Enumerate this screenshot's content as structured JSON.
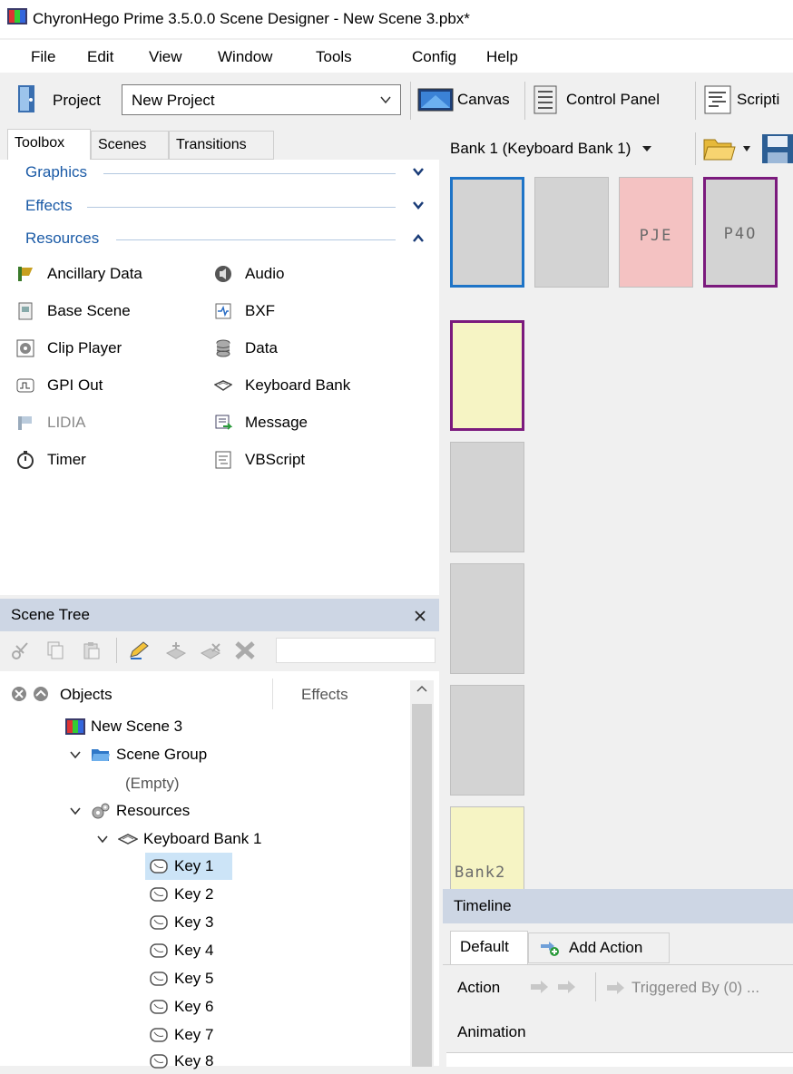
{
  "window": {
    "title": "ChyronHego Prime 3.5.0.0 Scene Designer - New Scene 3.pbx*"
  },
  "menu": [
    "File",
    "Edit",
    "View",
    "Window",
    "Tools",
    "Config",
    "Help"
  ],
  "project": {
    "label": "Project",
    "value": "New Project"
  },
  "view_buttons": {
    "canvas": "Canvas",
    "control_panel": "Control Panel",
    "scripting": "Scripti"
  },
  "left_tabs": [
    "Toolbox",
    "Scenes",
    "Transitions"
  ],
  "toolbox": {
    "sections": [
      "Graphics",
      "Effects",
      "Resources"
    ],
    "items_left": [
      "Ancillary Data",
      "Base Scene",
      "Clip Player",
      "GPI Out",
      "LIDIA",
      "Timer"
    ],
    "items_right": [
      "Audio",
      "BXF",
      "Data",
      "Keyboard Bank",
      "Message",
      "VBScript"
    ]
  },
  "bank": {
    "selector": "Bank 1 (Keyboard Bank 1)"
  },
  "keys": {
    "k3": "PJE",
    "k4": "P4O",
    "bank2": "Bank2"
  },
  "scene_tree": {
    "title": "Scene Tree",
    "col_objects": "Objects",
    "col_effects": "Effects",
    "nodes": {
      "root": "New Scene 3",
      "group": "Scene Group",
      "empty": "(Empty)",
      "resources": "Resources",
      "bank": "Keyboard Bank 1",
      "keys": [
        "Key 1",
        "Key 2",
        "Key 3",
        "Key 4",
        "Key 5",
        "Key 6",
        "Key 7",
        "Key 8"
      ]
    }
  },
  "timeline": {
    "title": "Timeline",
    "tab_default": "Default",
    "add_action": "Add Action",
    "action_label": "Action",
    "triggered_by": "Triggered By (0) ...",
    "animation_label": "Animation"
  },
  "colors": {
    "selection_blue": "#1e74c7",
    "purple_border": "#7b1a7d",
    "pink_key": "#f4c2c2",
    "yellow_key": "#f6f4c4"
  }
}
